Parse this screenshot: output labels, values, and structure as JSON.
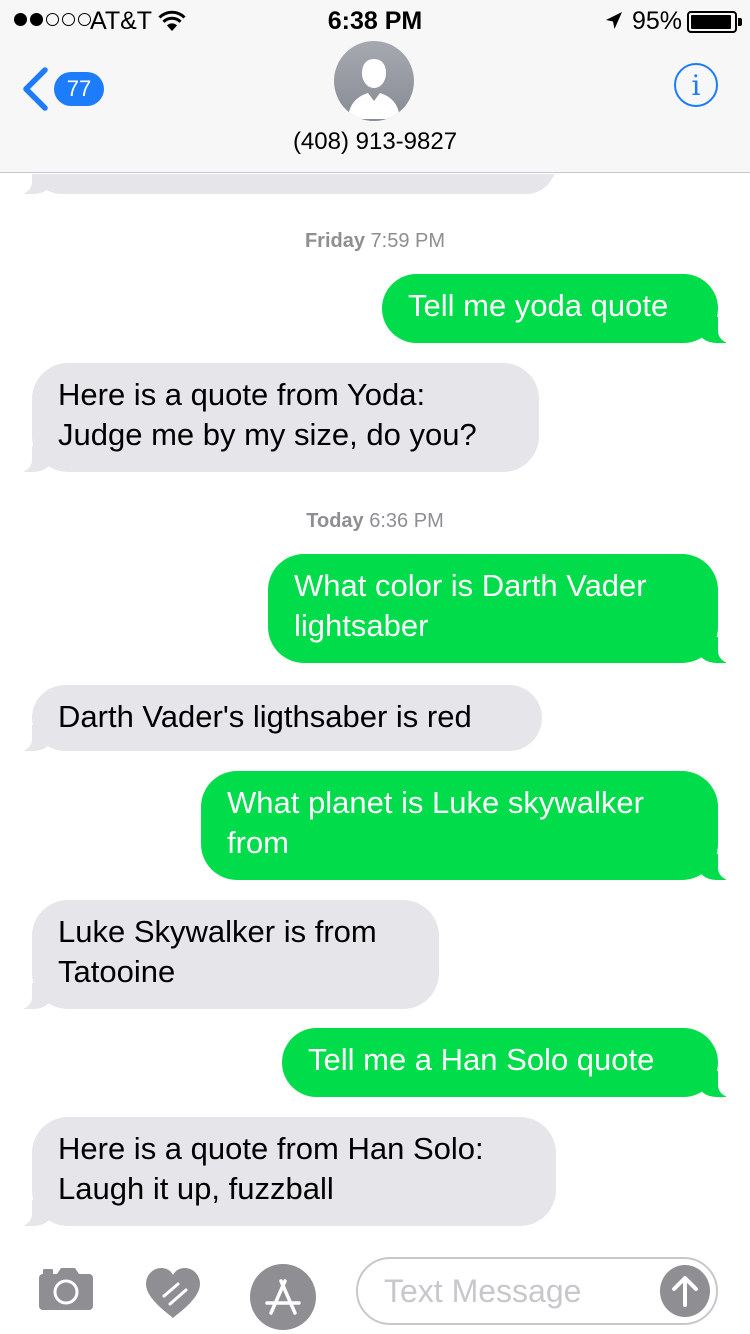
{
  "status_bar": {
    "carrier": "AT&T",
    "time": "6:38 PM",
    "battery": "95%",
    "battery_level": 0.95,
    "signal_bars_filled": 2,
    "signal_bars_total": 5
  },
  "header": {
    "back_count": "77",
    "contact": "(408) 913-9827",
    "info_label": "i",
    "accent_color": "#1c7cf9"
  },
  "conversation": {
    "ts1_day": "Friday",
    "ts1_time": "7:59 PM",
    "m1": "Tell me yoda quote",
    "m2": "Here is a quote from Yoda:\nJudge me by my size, do you?",
    "ts2_day": "Today",
    "ts2_time": "6:36 PM",
    "m3": "What color is Darth Vader\nlightsaber",
    "m4": "Darth Vader's ligthsaber is red",
    "m5": "What planet is Luke skywalker\nfrom",
    "m6": "Luke Skywalker is from\nTatooine",
    "m7": "Tell me a Han Solo quote",
    "m8": "Here is a quote from Han Solo:\nLaugh it up, fuzzball"
  },
  "input": {
    "placeholder": "Text Message"
  },
  "icons": {
    "camera": "camera-icon",
    "digital_touch": "digital-touch-heart-icon",
    "app_store": "app-store-icon",
    "send": "send-arrow-up-icon"
  },
  "colors": {
    "outgoing_bubble": "#00dc4a",
    "incoming_bubble": "#e5e5ea"
  }
}
